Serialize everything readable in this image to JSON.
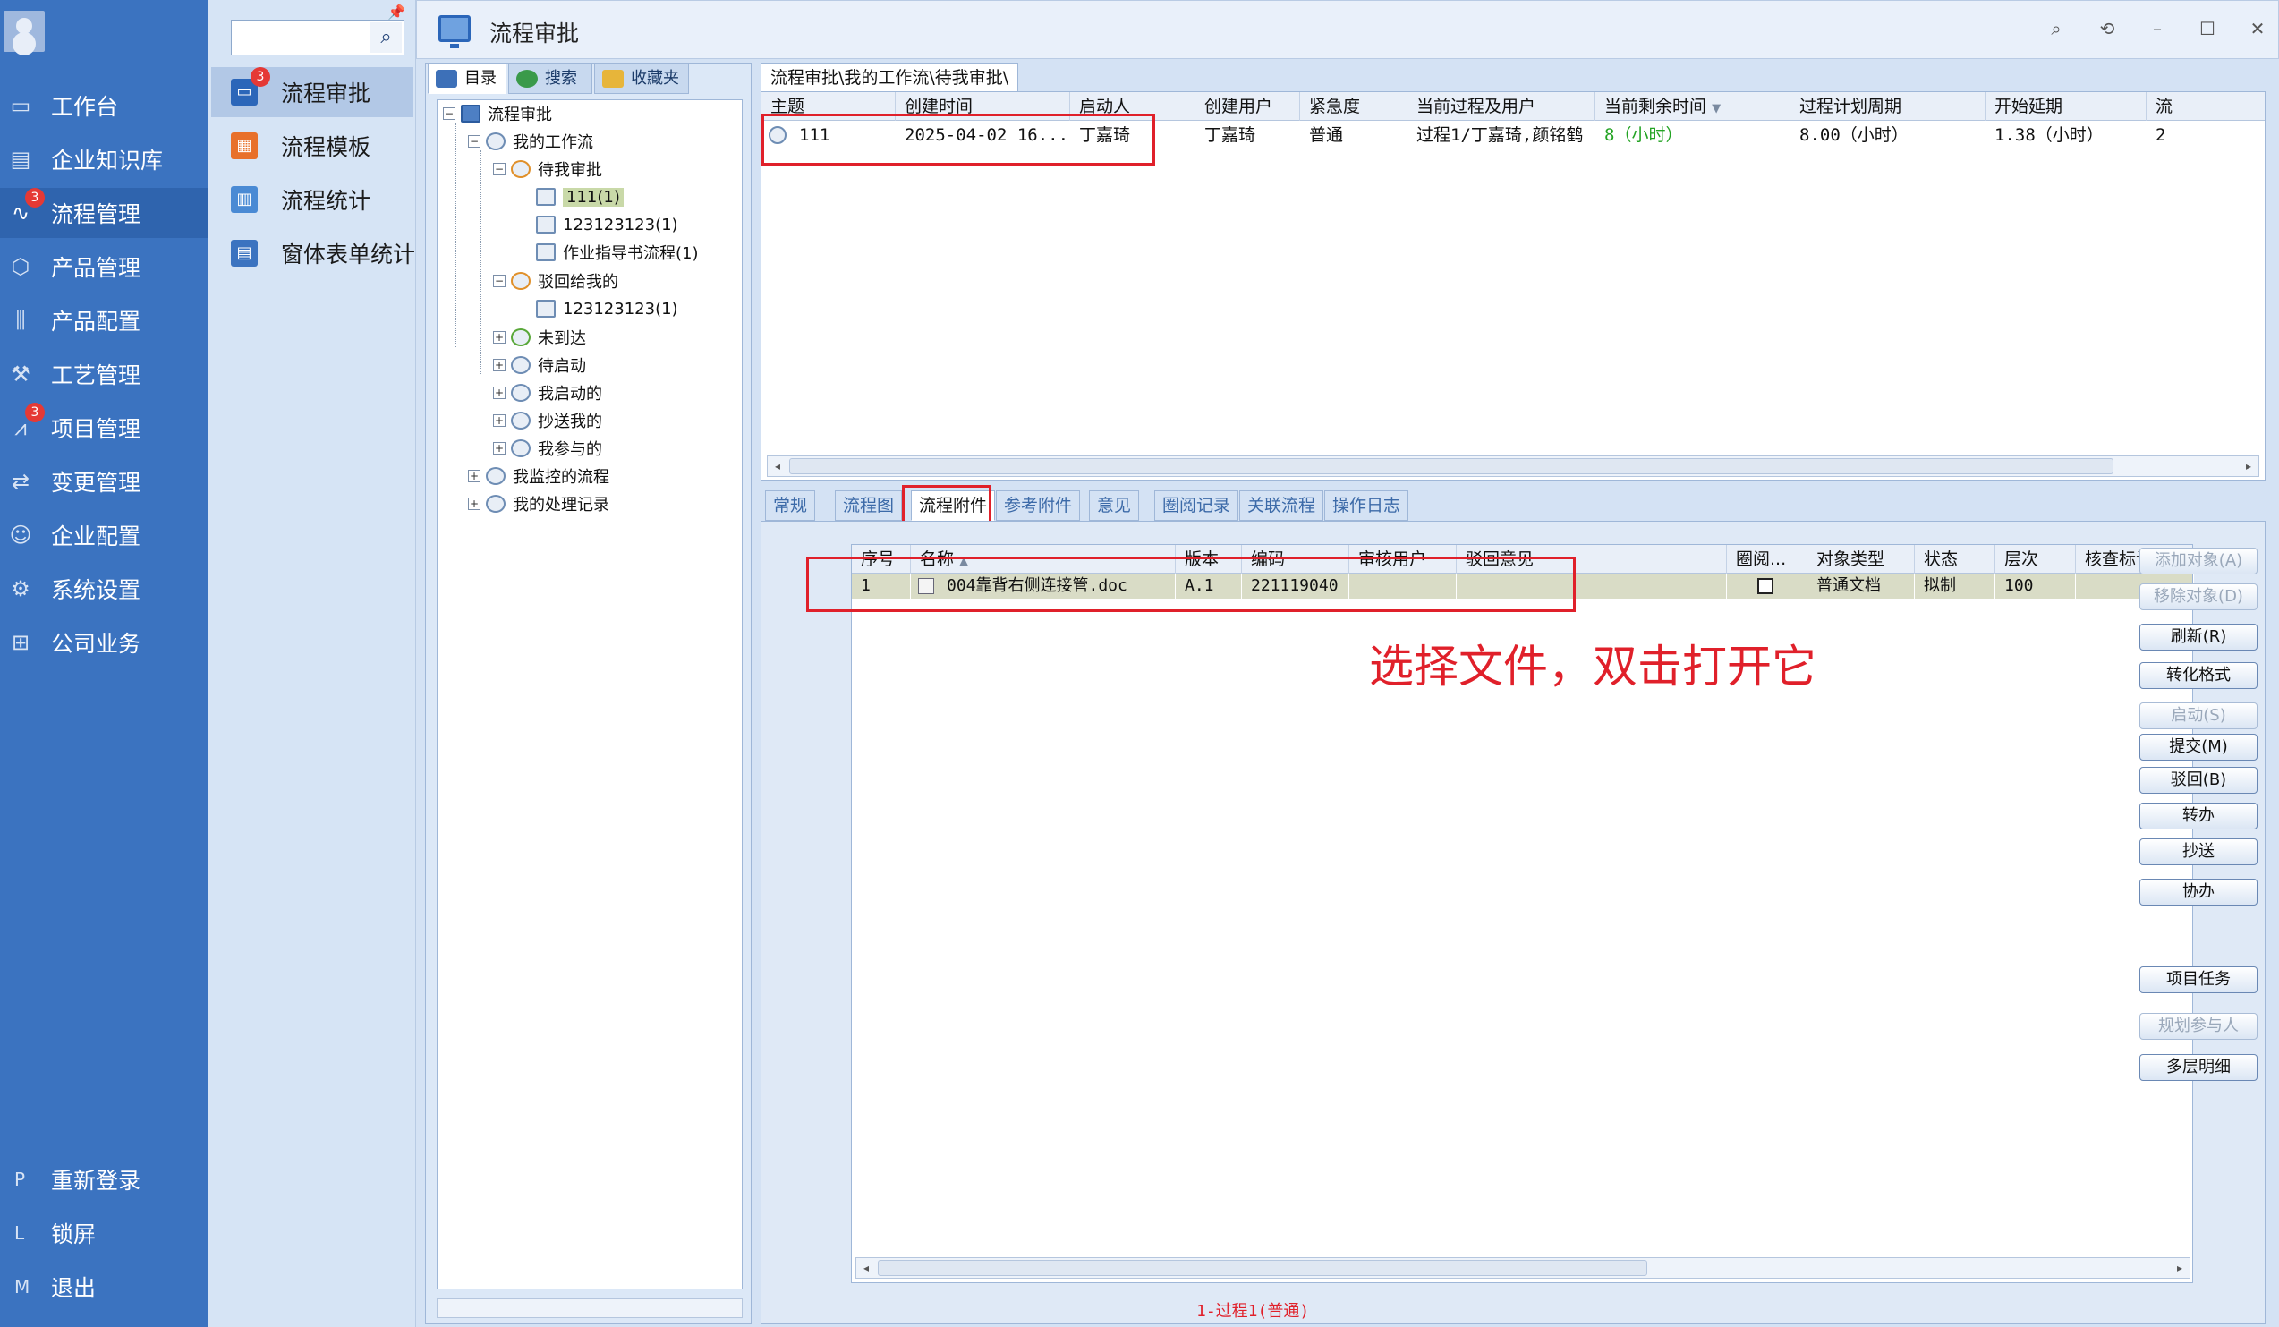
{
  "nav": {
    "items": [
      {
        "label": "工作台",
        "icon": "monitor-icon"
      },
      {
        "label": "企业知识库",
        "icon": "book-icon"
      },
      {
        "label": "流程管理",
        "icon": "flow-icon",
        "badge": "3"
      },
      {
        "label": "产品管理",
        "icon": "cube-icon"
      },
      {
        "label": "产品配置",
        "icon": "sliders-icon"
      },
      {
        "label": "工艺管理",
        "icon": "wrench-icon"
      },
      {
        "label": "项目管理",
        "icon": "chart-icon",
        "badge": "3"
      },
      {
        "label": "变更管理",
        "icon": "exchange-icon"
      },
      {
        "label": "企业配置",
        "icon": "users-icon"
      },
      {
        "label": "系统设置",
        "icon": "gear-icon"
      },
      {
        "label": "公司业务",
        "icon": "grid-icon"
      }
    ],
    "bottom": [
      {
        "key": "P",
        "label": "重新登录"
      },
      {
        "key": "L",
        "label": "锁屏"
      },
      {
        "key": "M",
        "label": "退出"
      }
    ]
  },
  "subnav": {
    "search_placeholder": "",
    "items": [
      {
        "label": "流程审批",
        "badge": "3"
      },
      {
        "label": "流程模板"
      },
      {
        "label": "流程统计"
      },
      {
        "label": "窗体表单统计"
      }
    ]
  },
  "window": {
    "title": "流程审批"
  },
  "dirtabs": [
    "目录",
    "搜索",
    "收藏夹"
  ],
  "tree": {
    "root": "流程审批",
    "my_workflow": "我的工作流",
    "pending": "待我审批",
    "pending_items": [
      "111(1)",
      "123123123(1)",
      "作业指导书流程(1)"
    ],
    "rejected": "驳回给我的",
    "rejected_items": [
      "123123123(1)"
    ],
    "others": [
      "未到达",
      "待启动",
      "我启动的",
      "抄送我的",
      "我参与的"
    ],
    "monitor": "我监控的流程",
    "records": "我的处理记录"
  },
  "breadcrumb": "流程审批\\我的工作流\\待我审批\\",
  "topgrid": {
    "columns": [
      "主题",
      "创建时间",
      "启动人",
      "创建用户",
      "紧急度",
      "当前过程及用户",
      "当前剩余时间",
      "过程计划周期",
      "开始延期",
      "流"
    ],
    "row": {
      "subject": "111",
      "created": "2025-04-02 16...",
      "starter": "丁嘉琦",
      "creator": "丁嘉琦",
      "urgency": "普通",
      "current": "过程1/丁嘉琦,颜铭鹤",
      "remaining": "8（小时）",
      "period": "8.00（小时）",
      "delay": "1.38（小时）",
      "extra": "2"
    }
  },
  "bottomtabs": [
    "常规",
    "流程图",
    "流程附件",
    "参考附件",
    "意见",
    "圈阅记录",
    "关联流程",
    "操作日志"
  ],
  "attgrid": {
    "columns": [
      "序号",
      "名称",
      "版本",
      "编码",
      "审核用户",
      "驳回意见",
      "圈阅...",
      "对象类型",
      "状态",
      "层次",
      "核查标记"
    ],
    "row": {
      "index": "1",
      "name": "004靠背右侧连接管.doc",
      "version": "A.1",
      "code": "221119040",
      "reviewer": "",
      "reject": "",
      "type": "普通文档",
      "status": "拟制",
      "level": "100",
      "check": ""
    }
  },
  "buttons": [
    {
      "label": "添加对象(A)",
      "enabled": false
    },
    {
      "label": "移除对象(D)",
      "enabled": false
    },
    {
      "label": "刷新(R)",
      "enabled": true
    },
    {
      "label": "转化格式",
      "enabled": true
    },
    {
      "label": "启动(S)",
      "enabled": false
    },
    {
      "label": "提交(M)",
      "enabled": true
    },
    {
      "label": "驳回(B)",
      "enabled": true
    },
    {
      "label": "转办",
      "enabled": true
    },
    {
      "label": "抄送",
      "enabled": true
    },
    {
      "label": "协办",
      "enabled": true
    },
    {
      "label": "项目任务",
      "enabled": true
    },
    {
      "label": "规划参与人",
      "enabled": false
    },
    {
      "label": "多层明细",
      "enabled": true
    }
  ],
  "annotation": "选择文件，双击打开它",
  "status": "1-过程1(普通)",
  "colors": {
    "nav_bg": "#3b73c0",
    "badge": "#e53935",
    "annotation": "#e0202a",
    "remaining": "#23a323"
  }
}
